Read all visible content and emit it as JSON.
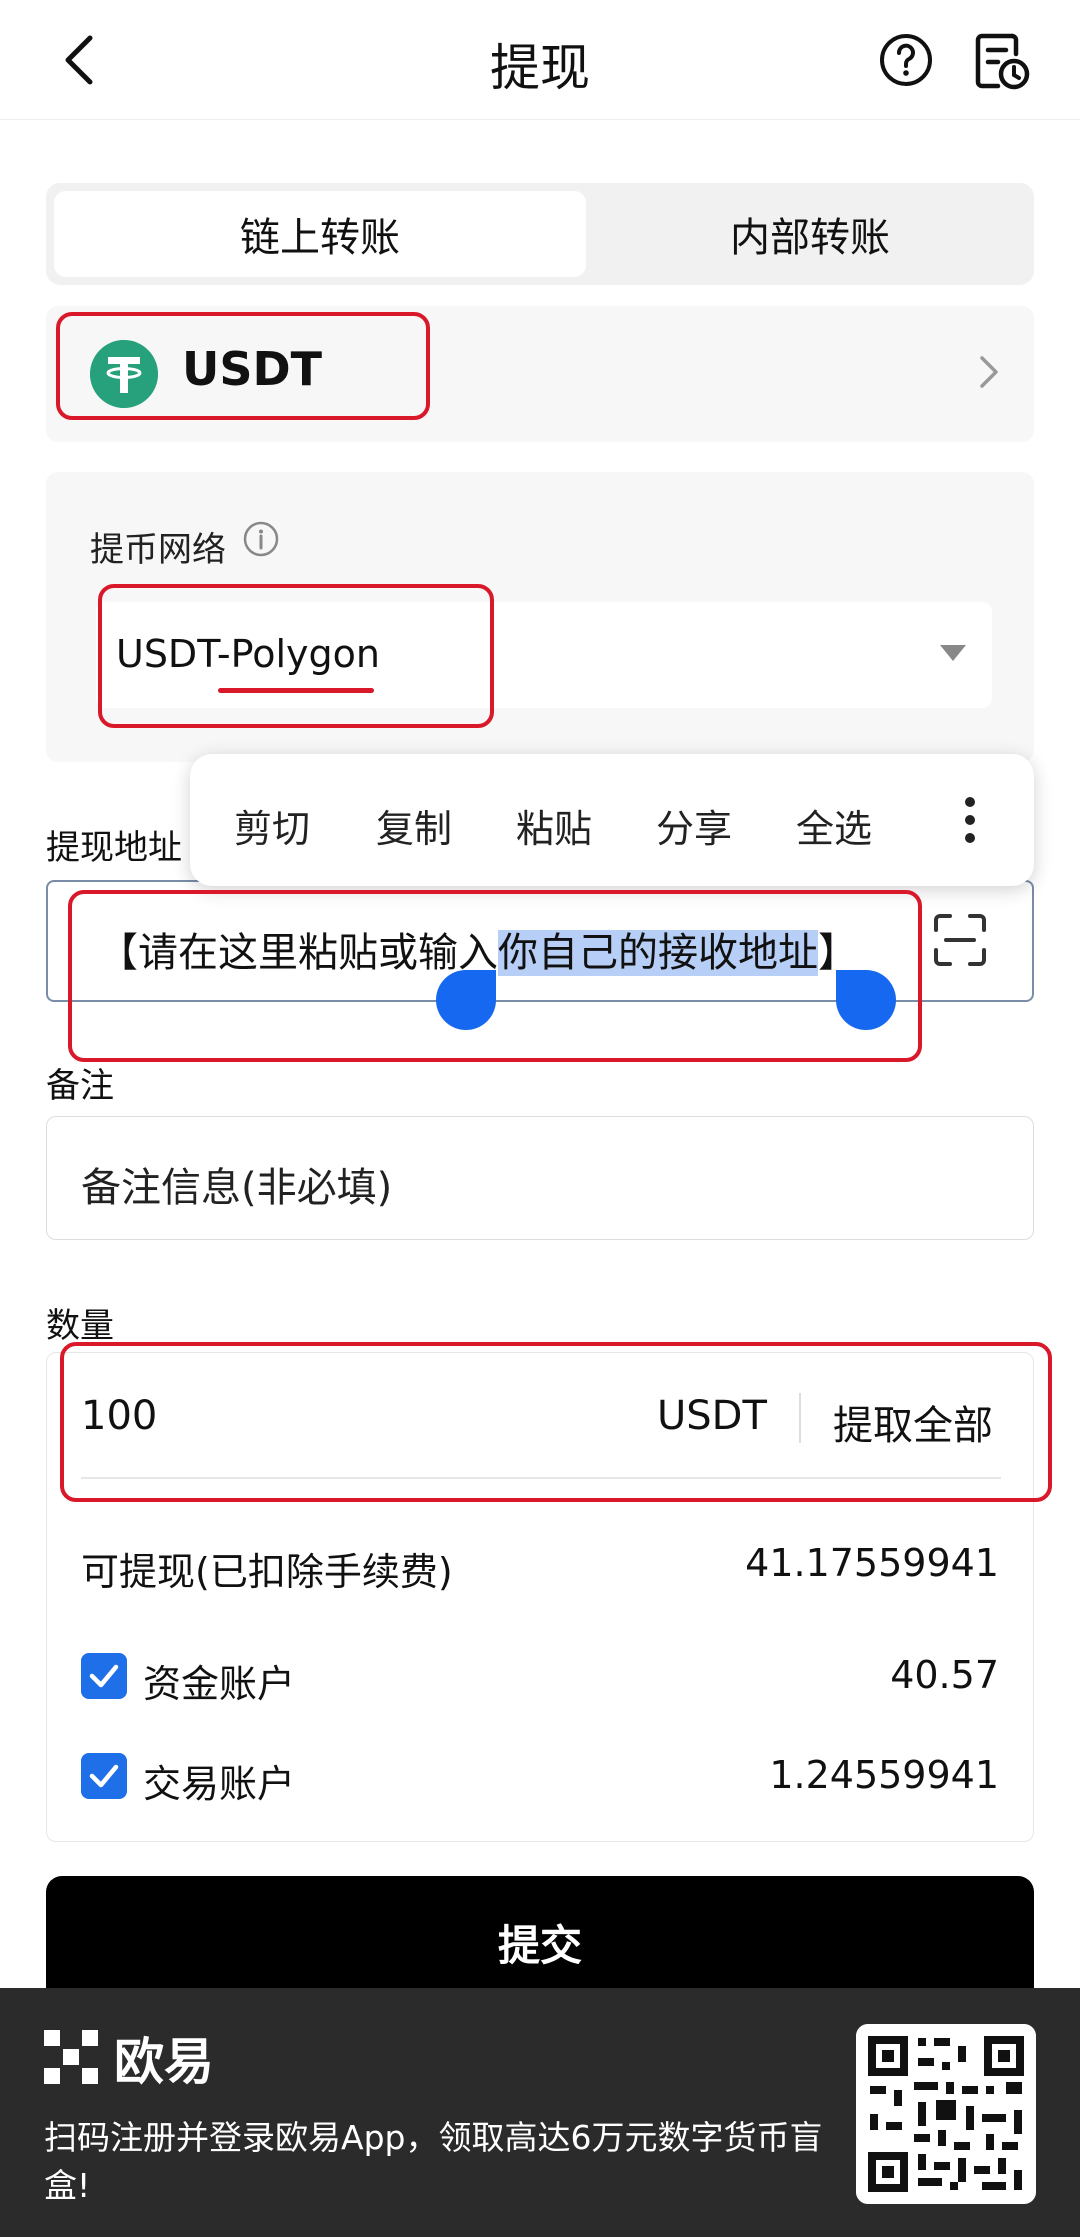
{
  "header": {
    "title": "提现"
  },
  "tabs": [
    {
      "label": "链上转账"
    },
    {
      "label": "内部转账"
    }
  ],
  "coin": {
    "name": "USDT"
  },
  "network": {
    "label": "提币网络",
    "value": "USDT-Polygon"
  },
  "address": {
    "label": "提现地址",
    "text_before": "【请在这里粘贴或输入",
    "text_selected": "你自己的接收地址",
    "text_after": "】"
  },
  "context_menu": {
    "items": [
      "剪切",
      "复制",
      "粘贴",
      "分享",
      "全选"
    ]
  },
  "remark": {
    "label": "备注",
    "placeholder": "备注信息(非必填)"
  },
  "amount": {
    "label": "数量",
    "value": "100",
    "unit": "USDT",
    "withdraw_all": "提取全部"
  },
  "balance": {
    "available_label": "可提现(已扣除手续费)",
    "available_value": "41.17559941",
    "accounts": [
      {
        "label": "资金账户",
        "value": "40.57",
        "checked": true
      },
      {
        "label": "交易账户",
        "value": "1.24559941",
        "checked": true
      }
    ]
  },
  "submit": {
    "label": "提交"
  },
  "banner": {
    "brand": "欧易",
    "promo": "扫码注册并登录欧易App，领取高达6万元数字货币盲盒!"
  },
  "colors": {
    "accent": "#1e6fe8",
    "tether": "#26a17b",
    "annotation_red": "#d9182a",
    "selection": "#b7cff6"
  }
}
